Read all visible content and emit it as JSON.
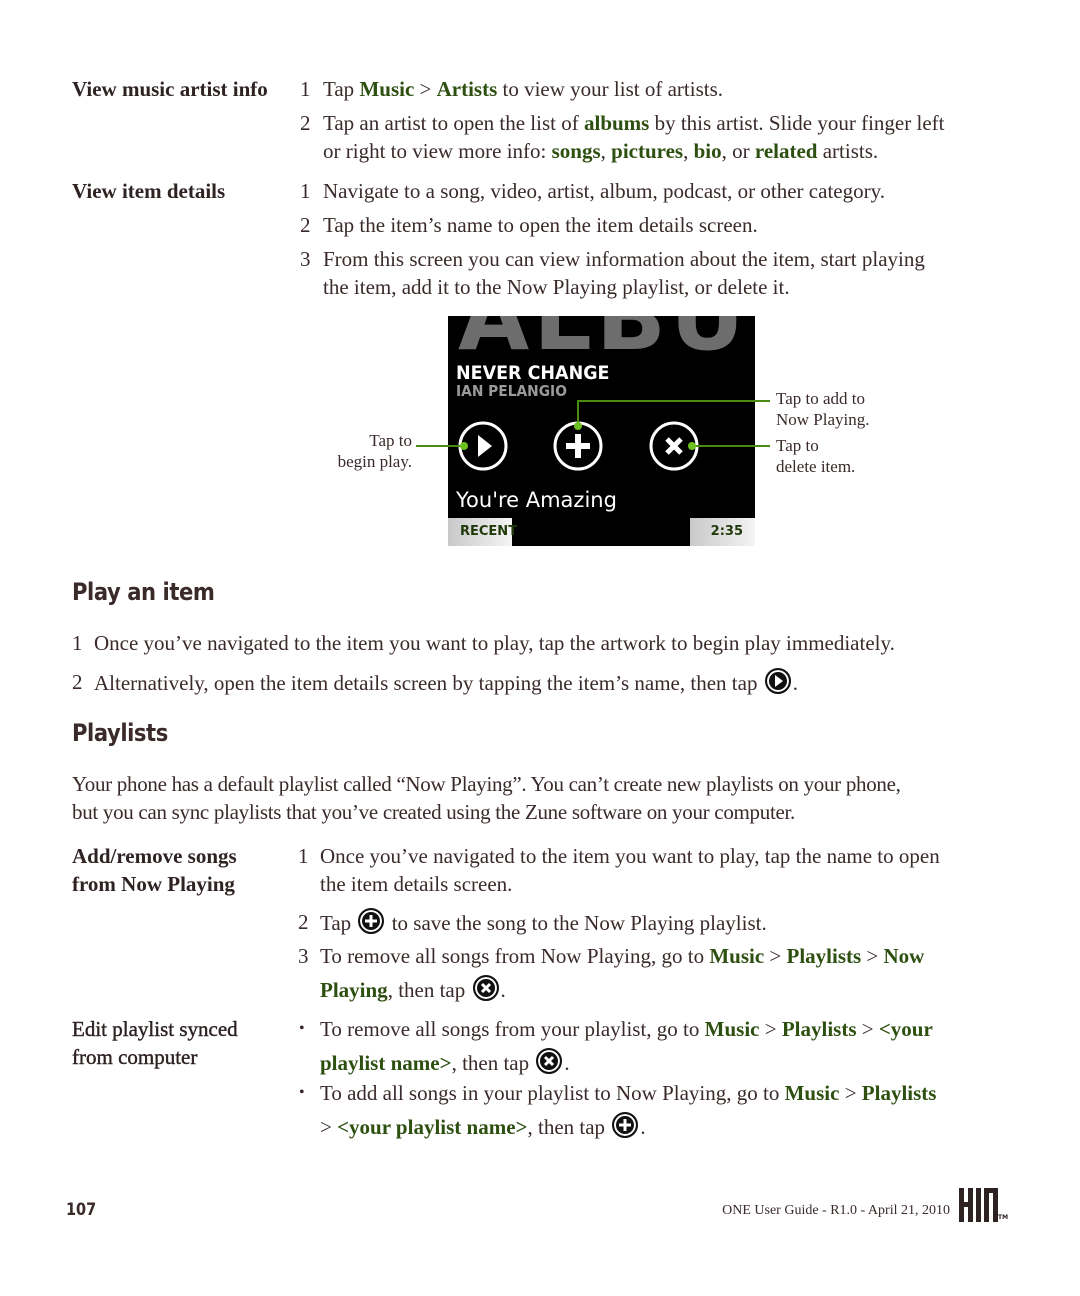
{
  "sections_top": [
    {
      "label": "View music artist info",
      "steps": [
        {
          "num": "1",
          "parts": [
            [
              "Tap ",
              false
            ],
            [
              "Music",
              true
            ],
            [
              " > ",
              false
            ],
            [
              "Artists",
              true
            ],
            [
              " to view your list of artists.",
              false
            ]
          ]
        },
        {
          "num": "2",
          "lines": [
            [
              [
                "Tap an artist to open the list of ",
                false
              ],
              [
                "albums",
                true
              ],
              [
                " by this artist. Slide your finger left",
                false
              ]
            ],
            [
              [
                "or right to view more info: ",
                false
              ],
              [
                "songs",
                true
              ],
              [
                ", ",
                false
              ],
              [
                "pictures",
                true
              ],
              [
                ", ",
                false
              ],
              [
                "bio",
                true
              ],
              [
                ", or ",
                false
              ],
              [
                "related",
                true
              ],
              [
                " artists.",
                false
              ]
            ]
          ]
        }
      ]
    },
    {
      "label": "View item details",
      "steps": [
        {
          "num": "1",
          "text": "Navigate to a song, video, artist, album, podcast, or other category."
        },
        {
          "num": "2",
          "text": "Tap the item’s name to open the item details screen."
        },
        {
          "num": "3",
          "line1": "From this screen you can view information about the item, start playing",
          "line2": "the item, add it to the Now Playing playlist, or delete it."
        }
      ]
    }
  ],
  "figure": {
    "background_text": "ALBU",
    "song_title": "NEVER CHANGE",
    "artist": "IAN PELANGIO",
    "track": "You're Amazing",
    "tab_left": "RECENT",
    "tab_right": "2:35",
    "callout_play": [
      "Tap to",
      "begin play."
    ],
    "callout_add": [
      "Tap to add to",
      "Now Playing."
    ],
    "callout_delete": [
      "Tap to",
      "delete item."
    ],
    "accent_color": "#4a8a10"
  },
  "play_section": {
    "heading": "Play an item",
    "steps": [
      {
        "num": "1",
        "text": "Once you’ve navigated to the item you want to play, tap the artwork to begin play immediately."
      },
      {
        "num": "2",
        "text": "Alternatively, open the item details screen by tapping the item’s name, then tap",
        "icon": "play-icon",
        "after": "."
      }
    ]
  },
  "playlists_section": {
    "heading": "Playlists",
    "intro_line1": "Your phone has a default playlist called “Now Playing”. You can’t create new playlists on your phone,",
    "intro_line2": "but you can sync playlists that you’ve created using the Zune software on your computer.",
    "add_remove": {
      "label_line1": "Add/remove songs",
      "label_line2": "from Now Playing",
      "step1_num": "1",
      "step1_line1": "Once you’ve navigated to the item you want to play, tap the name to open",
      "step1_line2": "the item details screen.",
      "step2_num": "2",
      "step2_pre": "Tap",
      "step2_post": "to save the song to the Now Playing playlist.",
      "step3_num": "3",
      "step3_pre": "To remove all songs from Now Playing, go to ",
      "step3_music": "Music",
      "step3_sep1": " > ",
      "step3_playlists": "Playlists",
      "step3_sep2": " > ",
      "step3_now": "Now",
      "step3_playing": "Playing",
      "step3_post": ", then tap",
      "step3_end": "."
    },
    "edit_synced": {
      "label_line1": "Edit playlist synced",
      "label_line2": "from computer",
      "bullet": "•",
      "b1_pre": "To remove all songs from your playlist, go to ",
      "b1_music": "Music",
      "b1_sep1": " > ",
      "b1_playlists": "Playlists",
      "b1_sep2": " > ",
      "b1_your": "<your",
      "b1_name": "playlist name>",
      "b1_post": ", then tap",
      "b1_end": ".",
      "b2_pre": "To add all songs in your playlist to Now Playing, go to ",
      "b2_music": "Music",
      "b2_sep1": " > ",
      "b2_playlists": "Playlists",
      "b2_sep2": "> ",
      "b2_name": "<your playlist name>",
      "b2_post": ", then tap",
      "b2_end": "."
    }
  },
  "footer": {
    "page_number": "107",
    "guide_text": "ONE User Guide - R1.0 - April 21, 2010",
    "logo": "KIN",
    "trademark": "TM"
  }
}
